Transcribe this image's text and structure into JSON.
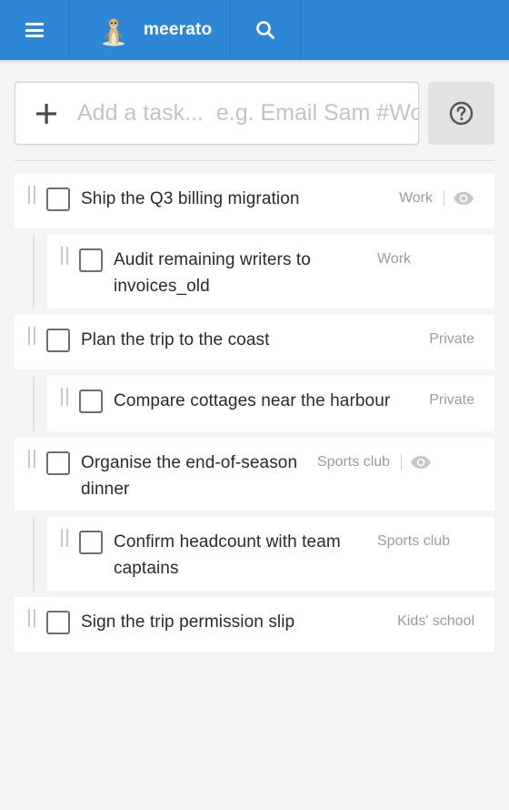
{
  "app": {
    "brand_name": "meerato",
    "accent_color": "#2d87d5"
  },
  "header": {
    "menu_icon": "hamburger-menu-icon",
    "logo_icon": "meerkat-logo",
    "search_icon": "search-icon"
  },
  "add_task": {
    "plus_icon": "plus-icon",
    "placeholder": "Add a task...  e.g. Email Sam #Work",
    "value": "",
    "help_icon": "question-circle-icon"
  },
  "tasks": [
    {
      "title": "Ship the Q3 billing migration",
      "project": "Work",
      "shared": true,
      "subtasks": [
        {
          "title": "Audit remaining writers to invoices_old",
          "project": "Work"
        }
      ]
    },
    {
      "title": "Plan the trip to the coast",
      "project": "Private",
      "shared": false,
      "subtasks": [
        {
          "title": "Compare cottages near the harbour",
          "project": "Private"
        }
      ]
    },
    {
      "title": "Organise the end-of-season dinner",
      "project": "Sports club",
      "shared": true,
      "subtasks": [
        {
          "title": "Confirm headcount with team captains",
          "project": "Sports club"
        }
      ]
    },
    {
      "title": "Sign the trip permission slip",
      "project": "Kids' school",
      "shared": false,
      "subtasks": []
    }
  ]
}
